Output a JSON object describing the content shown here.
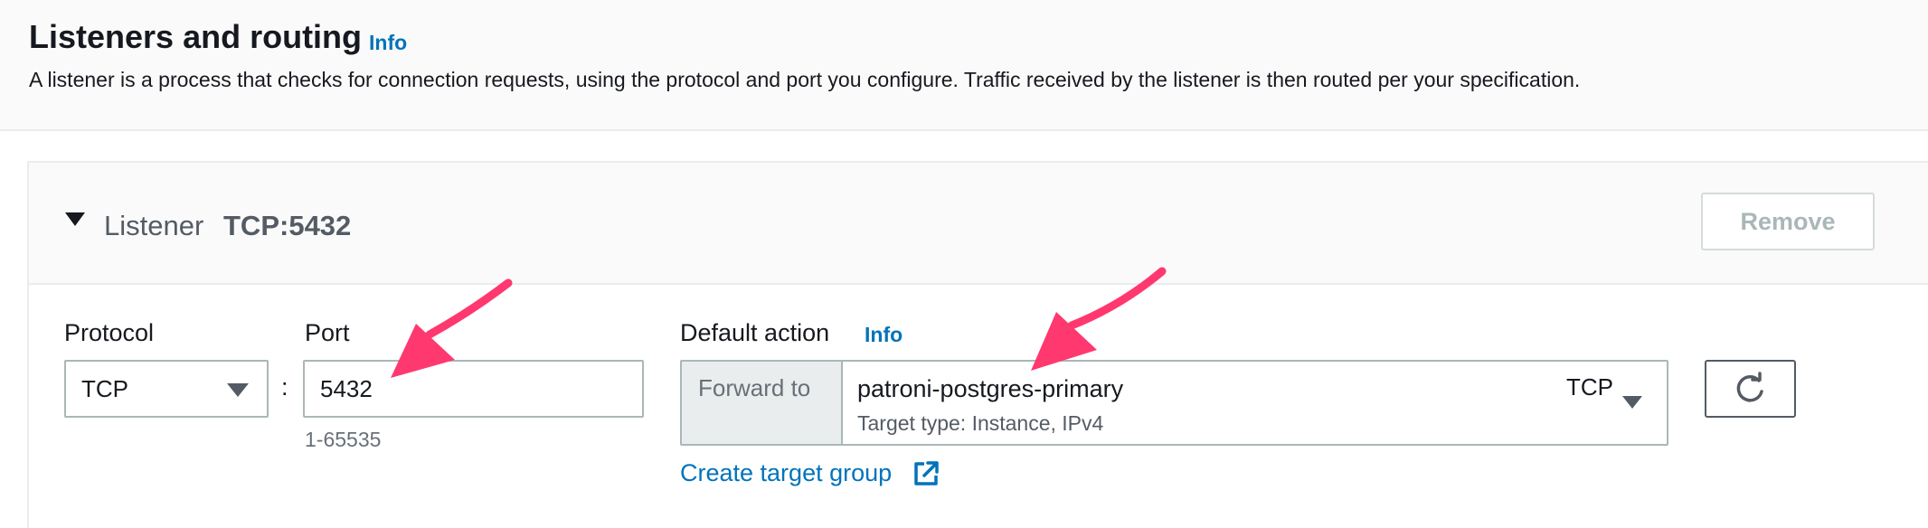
{
  "header": {
    "title": "Listeners and routing",
    "info": "Info",
    "description": "A listener is a process that checks for connection requests, using the protocol and port you configure. Traffic received by the listener is then routed per your specification."
  },
  "listener": {
    "label": "Listener",
    "name": "TCP:5432",
    "remove_label": "Remove"
  },
  "protocol": {
    "label": "Protocol",
    "value": "TCP"
  },
  "port": {
    "label": "Port",
    "value": "5432",
    "hint": "1-65535",
    "separator": ":"
  },
  "default_action": {
    "label": "Default action",
    "info": "Info",
    "addon": "Forward to",
    "target_group": "patroni-postgres-primary",
    "target_type": "Target type: Instance, IPv4",
    "protocol": "TCP",
    "create_link": "Create target group"
  },
  "icons": {
    "caret": "caret-down-icon",
    "refresh": "refresh-icon",
    "external": "external-link-icon",
    "annotation": "annotation-arrow"
  },
  "colors": {
    "link": "#0073bb",
    "annotation": "#ff3870"
  }
}
